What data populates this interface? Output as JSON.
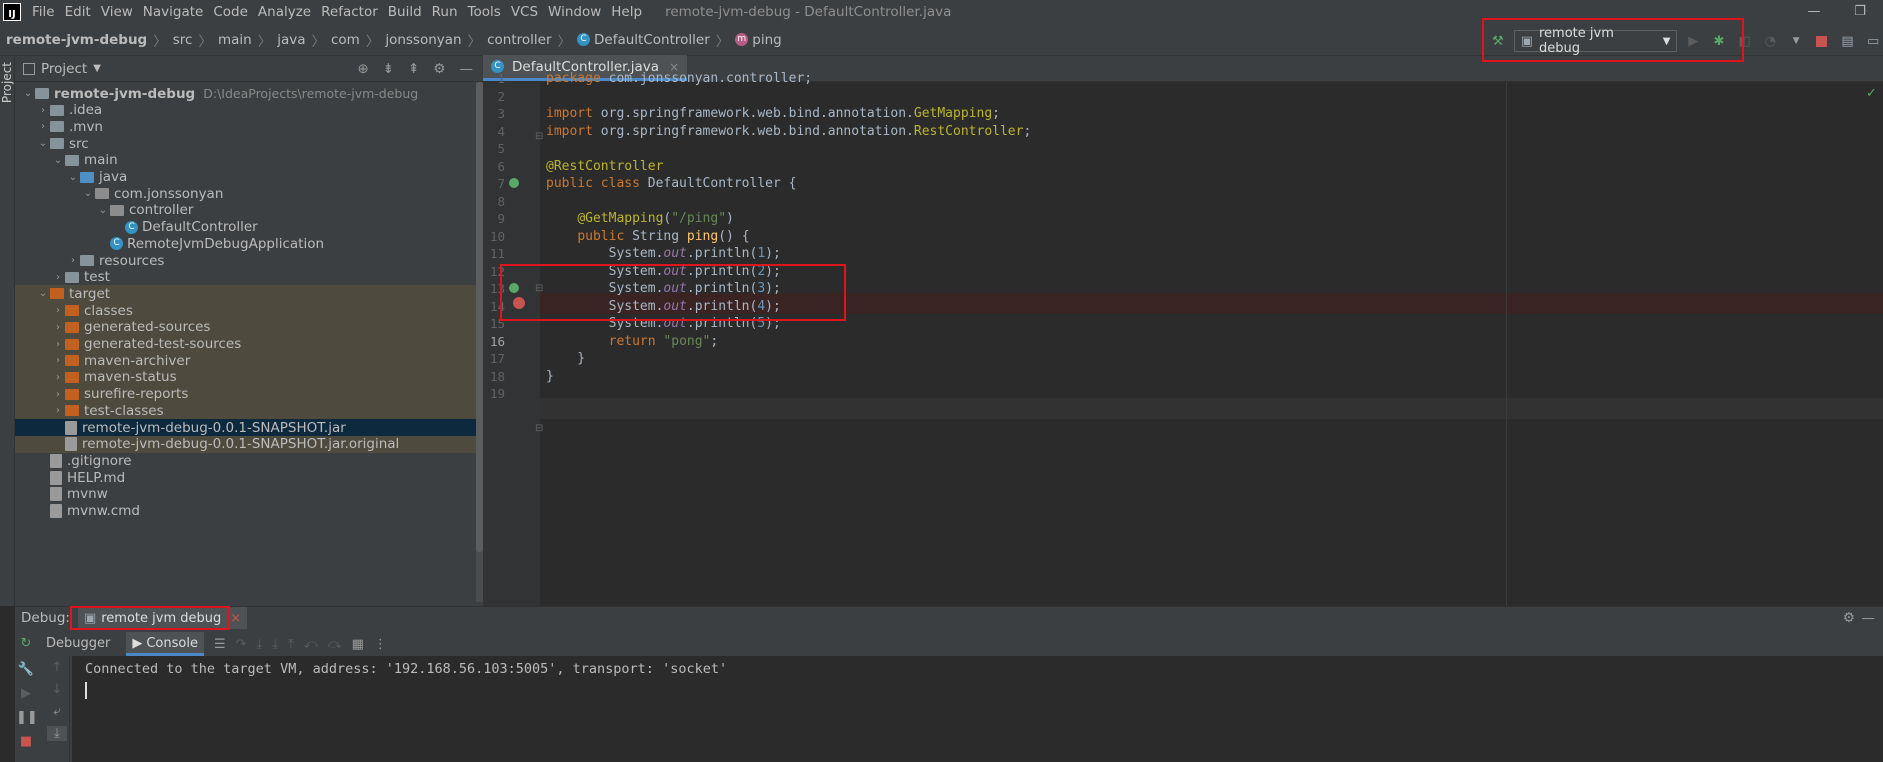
{
  "titlebar": {
    "menu": [
      "File",
      "Edit",
      "View",
      "Navigate",
      "Code",
      "Analyze",
      "Refactor",
      "Build",
      "Run",
      "Tools",
      "VCS",
      "Window",
      "Help"
    ],
    "window_title": "remote-jvm-debug - DefaultController.java",
    "minimize": "—",
    "restore": "❐"
  },
  "breadcrumbs": [
    "remote-jvm-debug",
    "src",
    "main",
    "java",
    "com",
    "jonssonyan",
    "controller",
    "DefaultController",
    "ping"
  ],
  "run_toolbar": {
    "config_name": "remote jvm debug"
  },
  "project_panel": {
    "title": "Project",
    "side_label": "Project",
    "tree": [
      {
        "label": "remote-jvm-debug",
        "path": "D:\\IdeaProjects\\remote-jvm-debug",
        "depth": 0,
        "expanded": true,
        "icon": "module-folder",
        "bold": true
      },
      {
        "label": ".idea",
        "depth": 1,
        "expanded": false,
        "icon": "folder"
      },
      {
        "label": ".mvn",
        "depth": 1,
        "expanded": false,
        "icon": "folder"
      },
      {
        "label": "src",
        "depth": 1,
        "expanded": true,
        "icon": "folder"
      },
      {
        "label": "main",
        "depth": 2,
        "expanded": true,
        "icon": "folder"
      },
      {
        "label": "java",
        "depth": 3,
        "expanded": true,
        "icon": "source-folder"
      },
      {
        "label": "com.jonssonyan",
        "depth": 4,
        "expanded": true,
        "icon": "package"
      },
      {
        "label": "controller",
        "depth": 5,
        "expanded": true,
        "icon": "package"
      },
      {
        "label": "DefaultController",
        "depth": 6,
        "icon": "class"
      },
      {
        "label": "RemoteJvmDebugApplication",
        "depth": 5,
        "icon": "spring-class"
      },
      {
        "label": "resources",
        "depth": 3,
        "expanded": false,
        "icon": "resources-folder"
      },
      {
        "label": "test",
        "depth": 2,
        "expanded": false,
        "icon": "folder"
      },
      {
        "label": "target",
        "depth": 1,
        "expanded": true,
        "icon": "excluded-folder",
        "excluded": true
      },
      {
        "label": "classes",
        "depth": 2,
        "expanded": false,
        "icon": "excluded-folder",
        "excluded": true
      },
      {
        "label": "generated-sources",
        "depth": 2,
        "expanded": false,
        "icon": "excluded-folder",
        "excluded": true
      },
      {
        "label": "generated-test-sources",
        "depth": 2,
        "expanded": false,
        "icon": "excluded-folder",
        "excluded": true
      },
      {
        "label": "maven-archiver",
        "depth": 2,
        "expanded": false,
        "icon": "excluded-folder",
        "excluded": true
      },
      {
        "label": "maven-status",
        "depth": 2,
        "expanded": false,
        "icon": "excluded-folder",
        "excluded": true
      },
      {
        "label": "surefire-reports",
        "depth": 2,
        "expanded": false,
        "icon": "excluded-folder",
        "excluded": true
      },
      {
        "label": "test-classes",
        "depth": 2,
        "expanded": false,
        "icon": "excluded-folder",
        "excluded": true
      },
      {
        "label": "remote-jvm-debug-0.0.1-SNAPSHOT.jar",
        "depth": 2,
        "icon": "jar-file",
        "selected": true
      },
      {
        "label": "remote-jvm-debug-0.0.1-SNAPSHOT.jar.original",
        "depth": 2,
        "icon": "file",
        "excluded": true
      },
      {
        "label": ".gitignore",
        "depth": 1,
        "icon": "file"
      },
      {
        "label": "HELP.md",
        "depth": 1,
        "icon": "markdown-file"
      },
      {
        "label": "mvnw",
        "depth": 1,
        "icon": "file"
      },
      {
        "label": "mvnw.cmd",
        "depth": 1,
        "icon": "file"
      }
    ]
  },
  "editor": {
    "tab_label": "DefaultController.java",
    "tab_close": "×",
    "lines": [
      {
        "n": "1",
        "t": [
          {
            "c": "kw",
            "s": "package "
          },
          {
            "c": "",
            "s": "com.jonssonyan.controller;"
          }
        ]
      },
      {
        "n": "2",
        "t": []
      },
      {
        "n": "3",
        "t": [
          {
            "c": "kw",
            "s": "import "
          },
          {
            "c": "",
            "s": "org.springframework.web.bind.annotation."
          },
          {
            "c": "ann",
            "s": "GetMapping"
          },
          {
            "c": "",
            "s": ";"
          }
        ]
      },
      {
        "n": "4",
        "t": [
          {
            "c": "kw",
            "s": "import "
          },
          {
            "c": "",
            "s": "org.springframework.web.bind.annotation."
          },
          {
            "c": "ann",
            "s": "RestController"
          },
          {
            "c": "",
            "s": ";"
          }
        ]
      },
      {
        "n": "5",
        "t": []
      },
      {
        "n": "6",
        "t": [
          {
            "c": "ann",
            "s": "@RestController"
          }
        ]
      },
      {
        "n": "7",
        "t": [
          {
            "c": "kw",
            "s": "public class "
          },
          {
            "c": "",
            "s": "DefaultController {"
          }
        ]
      },
      {
        "n": "8",
        "t": []
      },
      {
        "n": "9",
        "t": [
          {
            "c": "",
            "s": "    "
          },
          {
            "c": "ann",
            "s": "@GetMapping"
          },
          {
            "c": "",
            "s": "("
          },
          {
            "c": "str",
            "s": "\"/ping\""
          },
          {
            "c": "",
            "s": ")"
          }
        ]
      },
      {
        "n": "10",
        "t": [
          {
            "c": "",
            "s": "    "
          },
          {
            "c": "kw",
            "s": "public "
          },
          {
            "c": "",
            "s": "String "
          },
          {
            "c": "fn",
            "s": "ping"
          },
          {
            "c": "",
            "s": "() {"
          }
        ]
      },
      {
        "n": "11",
        "t": [
          {
            "c": "",
            "s": "        System."
          },
          {
            "c": "fld",
            "s": "out"
          },
          {
            "c": "",
            "s": ".println("
          },
          {
            "c": "num",
            "s": "1"
          },
          {
            "c": "",
            "s": ");"
          }
        ]
      },
      {
        "n": "12",
        "t": [
          {
            "c": "",
            "s": "        System."
          },
          {
            "c": "fld",
            "s": "out"
          },
          {
            "c": "",
            "s": ".println("
          },
          {
            "c": "num",
            "s": "2"
          },
          {
            "c": "",
            "s": ");"
          }
        ]
      },
      {
        "n": "13",
        "t": [
          {
            "c": "",
            "s": "        System."
          },
          {
            "c": "fld",
            "s": "out"
          },
          {
            "c": "",
            "s": ".println("
          },
          {
            "c": "num",
            "s": "3"
          },
          {
            "c": "",
            "s": ");"
          }
        ]
      },
      {
        "n": "14",
        "t": [
          {
            "c": "",
            "s": "        System."
          },
          {
            "c": "fld",
            "s": "out"
          },
          {
            "c": "",
            "s": ".println("
          },
          {
            "c": "num",
            "s": "4"
          },
          {
            "c": "",
            "s": ");"
          }
        ]
      },
      {
        "n": "15",
        "t": [
          {
            "c": "",
            "s": "        System."
          },
          {
            "c": "fld",
            "s": "out"
          },
          {
            "c": "",
            "s": ".println("
          },
          {
            "c": "num",
            "s": "5"
          },
          {
            "c": "",
            "s": ");"
          }
        ]
      },
      {
        "n": "16",
        "t": [
          {
            "c": "",
            "s": "        "
          },
          {
            "c": "kw",
            "s": "return "
          },
          {
            "c": "str",
            "s": "\"pong\""
          },
          {
            "c": "",
            "s": ";"
          }
        ]
      },
      {
        "n": "17",
        "t": [
          {
            "c": "",
            "s": "    }"
          }
        ]
      },
      {
        "n": "18",
        "t": [
          {
            "c": "",
            "s": "}"
          }
        ]
      },
      {
        "n": "19",
        "t": []
      }
    ],
    "current_line": "16",
    "breakpoint_line": "11"
  },
  "debug": {
    "label": "Debug:",
    "session_tab": "remote jvm debug",
    "session_close": "×",
    "subtabs": [
      "Debugger",
      "Console"
    ],
    "active_subtab": "Console",
    "console_output": "Connected to the target VM, address: '192.168.56.103:5005', transport: 'socket'"
  },
  "colors": {
    "highlight_box": "#e0141d",
    "accent": "#4a88c7"
  }
}
